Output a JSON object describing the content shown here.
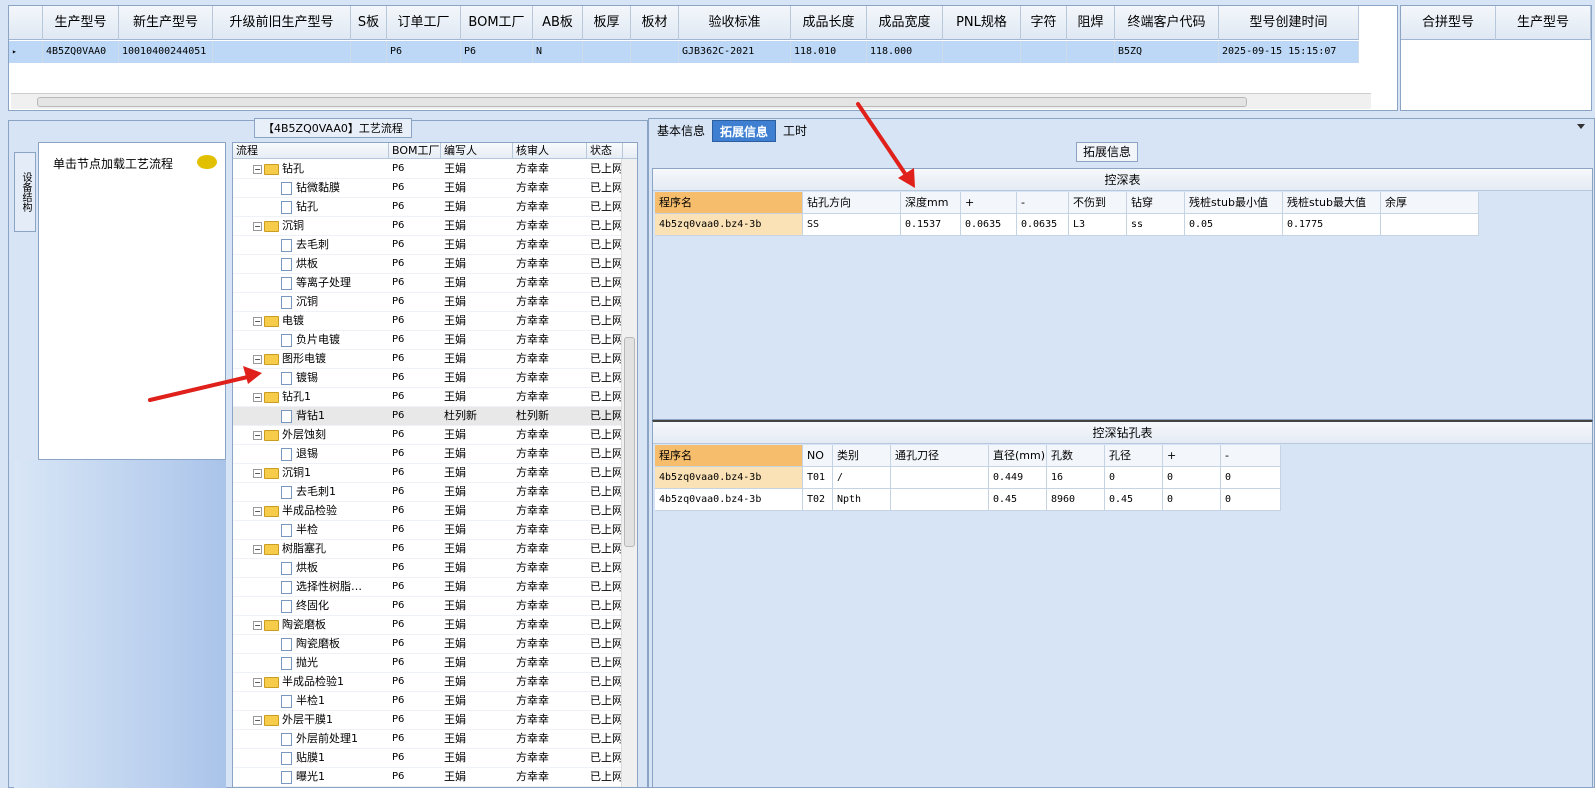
{
  "top_grid": {
    "headers": [
      "生产型号",
      "新生产型号",
      "升级前旧生产型号",
      "S板",
      "订单工厂",
      "BOM工厂",
      "AB板",
      "板厚",
      "板材",
      "验收标准",
      "成品长度",
      "成品宽度",
      "PNL规格",
      "字符",
      "阻焊",
      "终端客户代码",
      "型号创建时间"
    ],
    "row": [
      "4B5ZQ0VAA0",
      "10010400244051",
      "",
      "",
      "P6",
      "P6",
      "N",
      "",
      "",
      "GJB362C-2021",
      "118.010",
      "118.000",
      "",
      "",
      "",
      "B5ZQ",
      "2025-09-15 15:15:07"
    ]
  },
  "merge_panel": {
    "headers": [
      "合拼型号",
      "生产型号"
    ]
  },
  "left": {
    "title": "【4B5ZQ0VAA0】工艺流程",
    "side_tab": "设备结构",
    "hint": "单击节点加载工艺流程"
  },
  "tree": {
    "headers": [
      "流程",
      "BOM工厂",
      "编写人",
      "核审人",
      "状态"
    ],
    "rows": [
      {
        "level": 0,
        "name": "钻孔",
        "bom": "P6",
        "writer": "王娟",
        "reviewer": "方幸幸",
        "status": "已上网"
      },
      {
        "level": 1,
        "name": "钻微黏膜",
        "bom": "P6",
        "writer": "王娟",
        "reviewer": "方幸幸",
        "status": "已上网"
      },
      {
        "level": 1,
        "name": "钻孔",
        "bom": "P6",
        "writer": "王娟",
        "reviewer": "方幸幸",
        "status": "已上网"
      },
      {
        "level": 0,
        "name": "沉铜",
        "bom": "P6",
        "writer": "王娟",
        "reviewer": "方幸幸",
        "status": "已上网"
      },
      {
        "level": 1,
        "name": "去毛刺",
        "bom": "P6",
        "writer": "王娟",
        "reviewer": "方幸幸",
        "status": "已上网"
      },
      {
        "level": 1,
        "name": "烘板",
        "bom": "P6",
        "writer": "王娟",
        "reviewer": "方幸幸",
        "status": "已上网"
      },
      {
        "level": 1,
        "name": "等离子处理",
        "bom": "P6",
        "writer": "王娟",
        "reviewer": "方幸幸",
        "status": "已上网"
      },
      {
        "level": 1,
        "name": "沉铜",
        "bom": "P6",
        "writer": "王娟",
        "reviewer": "方幸幸",
        "status": "已上网"
      },
      {
        "level": 0,
        "name": "电镀",
        "bom": "P6",
        "writer": "王娟",
        "reviewer": "方幸幸",
        "status": "已上网"
      },
      {
        "level": 1,
        "name": "负片电镀",
        "bom": "P6",
        "writer": "王娟",
        "reviewer": "方幸幸",
        "status": "已上网"
      },
      {
        "level": 0,
        "name": "图形电镀",
        "bom": "P6",
        "writer": "王娟",
        "reviewer": "方幸幸",
        "status": "已上网"
      },
      {
        "level": 1,
        "name": "镀锡",
        "bom": "P6",
        "writer": "王娟",
        "reviewer": "方幸幸",
        "status": "已上网"
      },
      {
        "level": 0,
        "name": "钻孔1",
        "bom": "P6",
        "writer": "王娟",
        "reviewer": "方幸幸",
        "status": "已上网"
      },
      {
        "level": 1,
        "name": "背钻1",
        "bom": "P6",
        "writer": "杜列新",
        "reviewer": "杜列新",
        "status": "已上网",
        "selected": true
      },
      {
        "level": 0,
        "name": "外层蚀刻",
        "bom": "P6",
        "writer": "王娟",
        "reviewer": "方幸幸",
        "status": "已上网"
      },
      {
        "level": 1,
        "name": "退锡",
        "bom": "P6",
        "writer": "王娟",
        "reviewer": "方幸幸",
        "status": "已上网"
      },
      {
        "level": 0,
        "name": "沉铜1",
        "bom": "P6",
        "writer": "王娟",
        "reviewer": "方幸幸",
        "status": "已上网"
      },
      {
        "level": 1,
        "name": "去毛刺1",
        "bom": "P6",
        "writer": "王娟",
        "reviewer": "方幸幸",
        "status": "已上网"
      },
      {
        "level": 0,
        "name": "半成品检验",
        "bom": "P6",
        "writer": "王娟",
        "reviewer": "方幸幸",
        "status": "已上网"
      },
      {
        "level": 1,
        "name": "半检",
        "bom": "P6",
        "writer": "王娟",
        "reviewer": "方幸幸",
        "status": "已上网"
      },
      {
        "level": 0,
        "name": "树脂塞孔",
        "bom": "P6",
        "writer": "王娟",
        "reviewer": "方幸幸",
        "status": "已上网"
      },
      {
        "level": 1,
        "name": "烘板",
        "bom": "P6",
        "writer": "王娟",
        "reviewer": "方幸幸",
        "status": "已上网"
      },
      {
        "level": 1,
        "name": "选择性树脂…",
        "bom": "P6",
        "writer": "王娟",
        "reviewer": "方幸幸",
        "status": "已上网"
      },
      {
        "level": 1,
        "name": "终固化",
        "bom": "P6",
        "writer": "王娟",
        "reviewer": "方幸幸",
        "status": "已上网"
      },
      {
        "level": 0,
        "name": "陶瓷磨板",
        "bom": "P6",
        "writer": "王娟",
        "reviewer": "方幸幸",
        "status": "已上网"
      },
      {
        "level": 1,
        "name": "陶瓷磨板",
        "bom": "P6",
        "writer": "王娟",
        "reviewer": "方幸幸",
        "status": "已上网"
      },
      {
        "level": 1,
        "name": "抛光",
        "bom": "P6",
        "writer": "王娟",
        "reviewer": "方幸幸",
        "status": "已上网"
      },
      {
        "level": 0,
        "name": "半成品检验1",
        "bom": "P6",
        "writer": "王娟",
        "reviewer": "方幸幸",
        "status": "已上网"
      },
      {
        "level": 1,
        "name": "半检1",
        "bom": "P6",
        "writer": "王娟",
        "reviewer": "方幸幸",
        "status": "已上网"
      },
      {
        "level": 0,
        "name": "外层干膜1",
        "bom": "P6",
        "writer": "王娟",
        "reviewer": "方幸幸",
        "status": "已上网"
      },
      {
        "level": 1,
        "name": "外层前处理1",
        "bom": "P6",
        "writer": "王娟",
        "reviewer": "方幸幸",
        "status": "已上网"
      },
      {
        "level": 1,
        "name": "贴膜1",
        "bom": "P6",
        "writer": "王娟",
        "reviewer": "方幸幸",
        "status": "已上网"
      },
      {
        "level": 1,
        "name": "曝光1",
        "bom": "P6",
        "writer": "王娟",
        "reviewer": "方幸幸",
        "status": "已上网"
      }
    ]
  },
  "right": {
    "tabs": [
      "基本信息",
      "拓展信息",
      "工时"
    ],
    "active_tab": 1,
    "section_label": "拓展信息",
    "depth_table": {
      "title": "控深表",
      "headers": [
        "程序名",
        "钻孔方向",
        "深度mm",
        "+",
        "-",
        "不伤到",
        "钻穿",
        "残桩stub最小值",
        "残桩stub最大值",
        "余厚"
      ],
      "rows": [
        [
          "4b5zq0vaa0.bz4-3b",
          "SS",
          "0.1537",
          "0.0635",
          "0.0635",
          "L3",
          "ss",
          "0.05",
          "0.1775",
          ""
        ]
      ]
    },
    "hole_table": {
      "title": "控深钻孔表",
      "headers": [
        "程序名",
        "NO",
        "类别",
        "通孔刀径",
        "直径(mm)",
        "孔数",
        "孔径",
        "+",
        "-"
      ],
      "rows": [
        [
          "4b5zq0vaa0.bz4-3b",
          "T01",
          "/",
          "",
          "0.449",
          "16",
          "0",
          "0",
          "0"
        ],
        [
          "4b5zq0vaa0.bz4-3b",
          "T02",
          "Npth",
          "",
          "0.45",
          "8960",
          "0.45",
          "0",
          "0"
        ]
      ]
    }
  },
  "colors": {
    "accent": "#3e7fd2",
    "selected_row": "#bcd8f6",
    "highlight": "#f6be6c",
    "arrow": "#e0201a"
  }
}
